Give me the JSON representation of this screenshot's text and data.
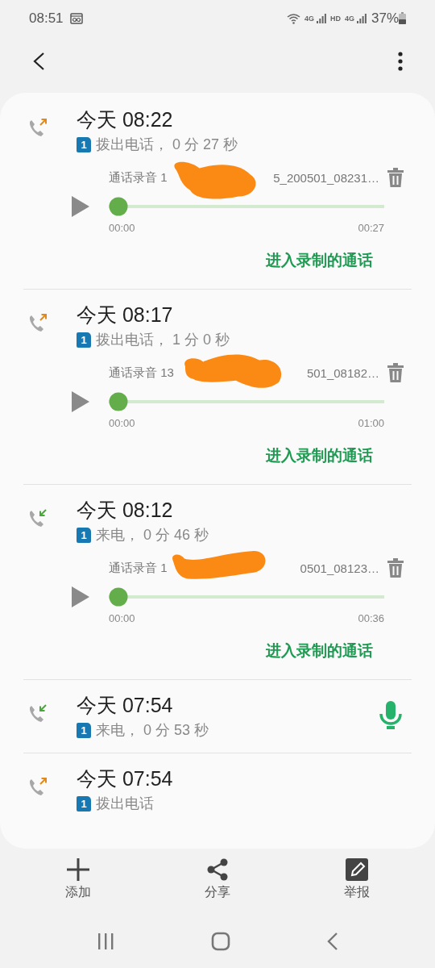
{
  "status_bar": {
    "time": "08:51",
    "network_labels": [
      "4G",
      "HD",
      "4G"
    ],
    "battery": "37%"
  },
  "calls": [
    {
      "kind": "recorded",
      "outgoing": true,
      "title": "今天 08:22",
      "sim": "1",
      "detail": "拨出电话， 0 分 27 秒",
      "recording": {
        "name_start": "通话录音 1",
        "name_end": "5_200501_08231…",
        "level": 0,
        "elapsed": "00:00",
        "total": "00:27"
      },
      "link": "进入录制的通话"
    },
    {
      "kind": "recorded",
      "outgoing": true,
      "title": "今天 08:17",
      "sim": "1",
      "detail": "拨出电话， 1 分 0 秒",
      "recording": {
        "name_start": "通话录音 13",
        "name_end": "501_08182…",
        "level": 0,
        "elapsed": "00:00",
        "total": "01:00"
      },
      "link": "进入录制的通话"
    },
    {
      "kind": "recorded",
      "outgoing": false,
      "title": "今天 08:12",
      "sim": "1",
      "detail": "来电， 0 分 46 秒",
      "recording": {
        "name_start": "通话录音 1",
        "name_end": "0501_08123…",
        "level": 0,
        "elapsed": "00:00",
        "total": "00:36"
      },
      "link": "进入录制的通话"
    },
    {
      "kind": "mic",
      "outgoing": false,
      "title": "今天 07:54",
      "sim": "1",
      "detail": "来电， 0 分 53 秒"
    },
    {
      "kind": "plain",
      "outgoing": true,
      "title": "今天 07:54",
      "sim": "1",
      "detail": "拨出电话"
    }
  ],
  "bottom_actions": [
    {
      "kind": "add",
      "label": "添加"
    },
    {
      "kind": "share",
      "label": "分享"
    },
    {
      "kind": "report",
      "label": "举报"
    }
  ]
}
